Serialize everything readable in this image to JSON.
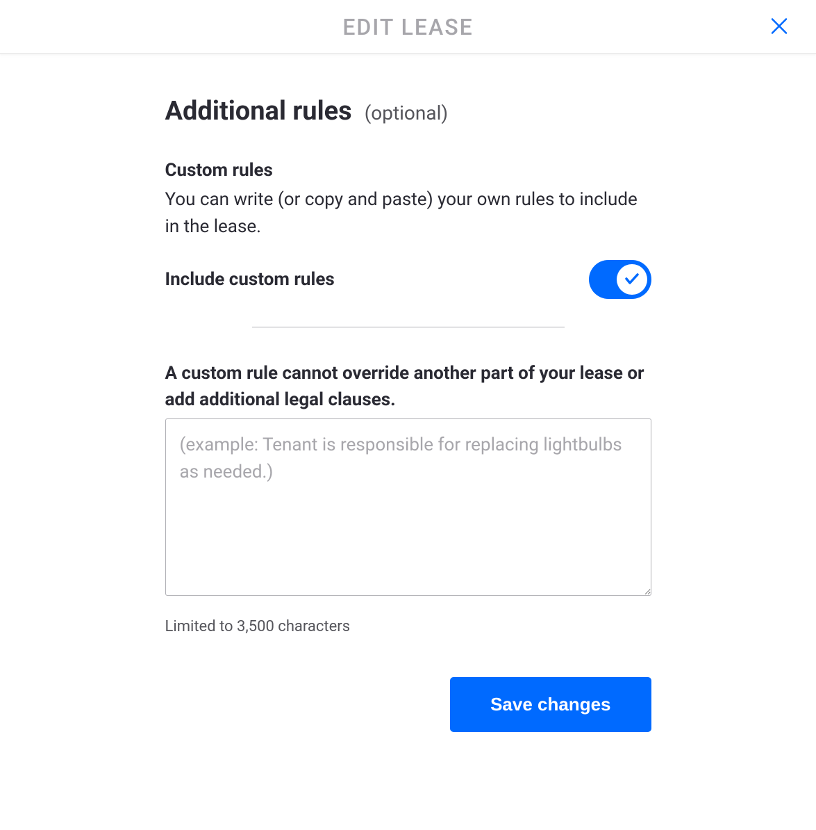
{
  "header": {
    "title": "EDIT LEASE"
  },
  "section": {
    "heading": "Additional rules",
    "optional": "(optional)"
  },
  "customRules": {
    "subheading": "Custom rules",
    "description": "You can write (or copy and paste) your own rules to include in the lease.",
    "toggleLabel": "Include custom rules",
    "toggleOn": true,
    "warning": "A custom rule cannot override another part of your lease or add additional legal clauses.",
    "placeholder": "(example: Tenant is responsible for replacing lightbulbs as needed.)",
    "value": "",
    "limitText": "Limited to 3,500 characters"
  },
  "buttons": {
    "save": "Save changes"
  },
  "colors": {
    "primary": "#006aff",
    "textMuted": "#a7a6ab"
  }
}
